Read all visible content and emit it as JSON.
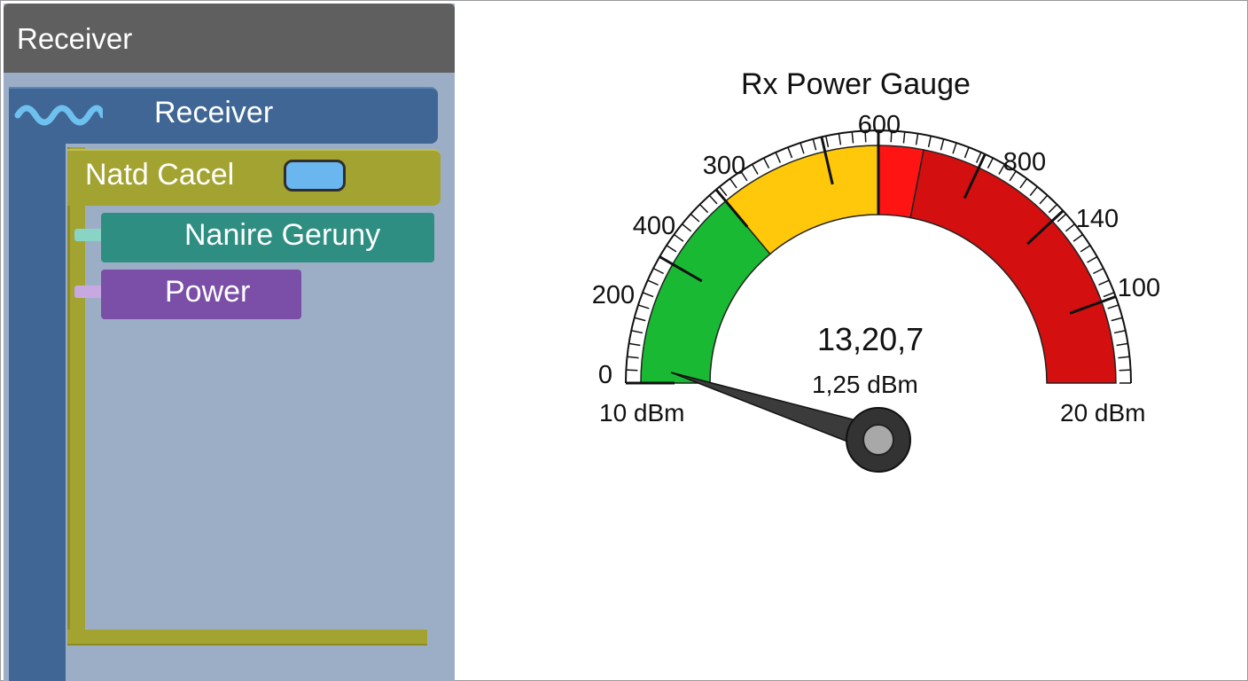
{
  "panel": {
    "title": "Receiver",
    "blocks": {
      "receiver": {
        "label": "Receiver",
        "icon": "wave-icon"
      },
      "natd": {
        "label": "Natd Cacel",
        "toggle_icon": "toggle-pill"
      },
      "nanire": {
        "label": "Nanire Geruny"
      },
      "power": {
        "label": "Power"
      }
    }
  },
  "gauge": {
    "title": "Rx Power Gauge",
    "ticks": [
      "0",
      "200",
      "400",
      "300",
      "600",
      "800",
      "140",
      "100"
    ],
    "min_label": "10 dBm",
    "max_label": "20 dBm",
    "readout": "13,20,7",
    "readout_sub": "1,25 dBm",
    "zones": [
      {
        "name": "green",
        "color": "#1ab934"
      },
      {
        "name": "yellow",
        "color": "#ffc80a"
      },
      {
        "name": "red",
        "color": "#ff1414"
      },
      {
        "name": "dark-red",
        "color": "#d30f0f"
      }
    ],
    "needle_value": 0.05
  }
}
